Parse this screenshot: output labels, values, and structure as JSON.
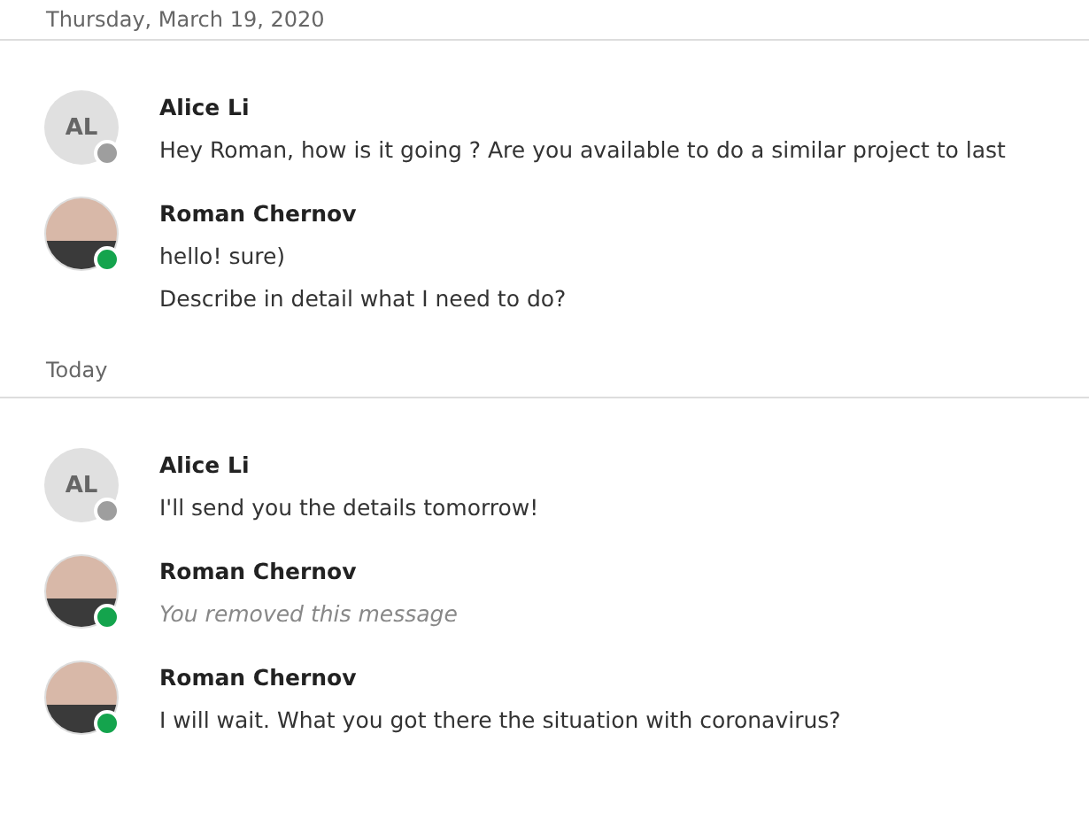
{
  "sections": [
    {
      "date": "Thursday, March 19, 2020",
      "groups": [
        {
          "author": "Alice Li",
          "avatar": {
            "kind": "initials",
            "text": "AL"
          },
          "online": false,
          "messages": [
            {
              "kind": "text",
              "text": "Hey Roman, how is it going ? Are you available to do a similar project to last"
            }
          ]
        },
        {
          "author": "Roman Chernov",
          "avatar": {
            "kind": "photo"
          },
          "online": true,
          "messages": [
            {
              "kind": "text",
              "text": "hello! sure)"
            },
            {
              "kind": "text",
              "text": "Describe in detail what I need to do?"
            }
          ]
        }
      ]
    },
    {
      "date": "Today",
      "groups": [
        {
          "author": "Alice Li",
          "avatar": {
            "kind": "initials",
            "text": "AL"
          },
          "online": false,
          "messages": [
            {
              "kind": "text",
              "text": "I'll send you the details tomorrow!"
            }
          ]
        },
        {
          "author": "Roman Chernov",
          "avatar": {
            "kind": "photo"
          },
          "online": true,
          "messages": [
            {
              "kind": "removed",
              "text": "You removed this message"
            }
          ]
        },
        {
          "author": "Roman Chernov",
          "avatar": {
            "kind": "photo"
          },
          "online": true,
          "messages": [
            {
              "kind": "text",
              "text": "I will wait. What you got there the situation with coronavirus?"
            }
          ]
        }
      ]
    }
  ]
}
